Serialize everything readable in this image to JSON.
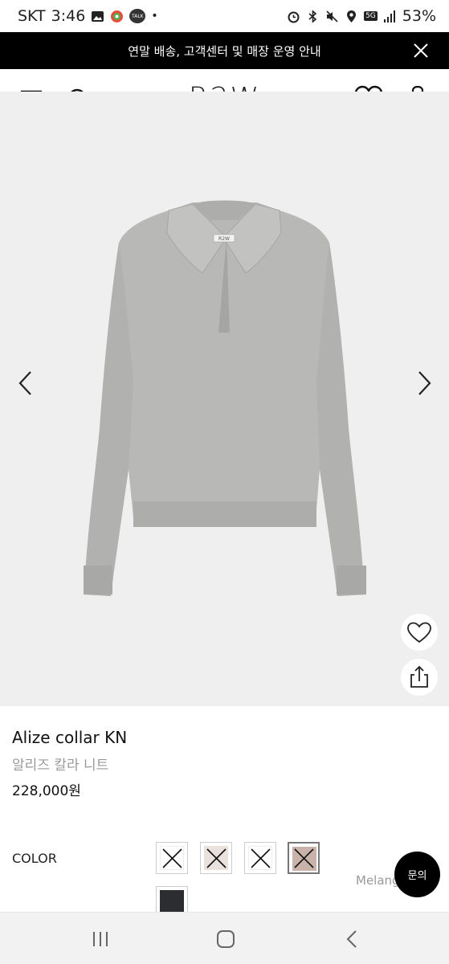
{
  "status_bar": {
    "carrier": "SKT",
    "time": "3:46",
    "talk_badge": "TALK",
    "network": "5G",
    "battery": "53%"
  },
  "announcement": {
    "text": "연말 배송, 고객센터 및 매장 운영 안내"
  },
  "header": {
    "logo": "R2W",
    "cart_count": "0"
  },
  "product": {
    "label_tag": "R2W",
    "name": "Alize collar KN",
    "name_ko": "알리즈 칼라 니트",
    "price": "228,000원",
    "color_label": "COLOR",
    "swatches": [
      {
        "color": "#ffffff",
        "sold_out": true
      },
      {
        "color": "#e8e1dc",
        "sold_out": true
      },
      {
        "color": "#ffffff",
        "sold_out": true
      },
      {
        "color": "#c9b2aa",
        "sold_out": true,
        "selected": true
      },
      {
        "color": "#2b2d31",
        "sold_out": false
      }
    ],
    "selected_color_name": "Melang"
  },
  "inquiry": {
    "label": "문의"
  },
  "colors": {
    "gallery_bg": "#efefef",
    "sweater": "#b8b8b6",
    "announce_bg": "#000000"
  }
}
